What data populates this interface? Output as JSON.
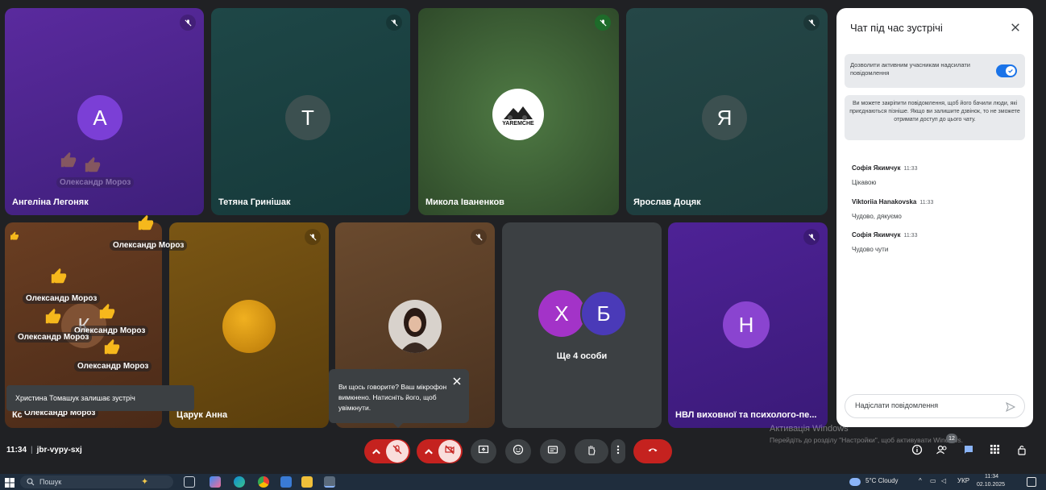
{
  "tiles": {
    "angelina": {
      "name": "Ангеліна Легоняк",
      "initial": "А"
    },
    "tetiana": {
      "name": "Тетяна Гринішак",
      "initial": "Т"
    },
    "mykola": {
      "name": "Микола Іваненков",
      "logo_text": "YAREMCHE"
    },
    "yaroslav": {
      "name": "Ярослав Доцяк",
      "initial": "Я"
    },
    "k_tile": {
      "name": "Кс",
      "initial": "К"
    },
    "tsaruk": {
      "name": "Царук Анна"
    },
    "photo_tile": {},
    "more": {
      "initial_1": "Х",
      "initial_2": "Б",
      "label": "Ще 4 особи"
    },
    "nvl": {
      "name": "НВЛ виховної та психолого-пе...",
      "initial": "Н"
    }
  },
  "reactions": {
    "sender": "Олександр Мороз"
  },
  "chat": {
    "title": "Чат під час зустрічі",
    "allow_label": "Дозволити активним учасникам надсилати повідомлення",
    "pin_info": "Ви можете закріпити повідомлення, щоб його бачили люди, які приєднаються пізніше. Якщо ви залишите дзвінок, то не зможете отримати доступ до цього чату.",
    "messages": [
      {
        "sender": "Софія Якимчук",
        "time": "11:33",
        "text": "Цікавою"
      },
      {
        "sender": "Viktoriia Hanakovska",
        "time": "11:33",
        "text": "Чудово, дякуємо"
      },
      {
        "sender": "Софія Якимчук",
        "time": "11:33",
        "text": "Чудово чути"
      }
    ],
    "input_placeholder": "Надіслати повідомлення"
  },
  "tooltip": {
    "text": "Ви щось говорите? Ваш мікрофон вимкнено. Натисніть його, щоб увімкнути."
  },
  "notification": {
    "text": "Христина Томашук залишає зустріч"
  },
  "meeting": {
    "time": "11:34",
    "code": "jbr-vypy-sxj",
    "participants_badge": "12"
  },
  "watermark": {
    "line1": "Активація Windows",
    "line2": "Перейдіть до розділу \"Настройки\", щоб активувати Windows."
  },
  "taskbar": {
    "search_placeholder": "Пошук",
    "weather": "5°C  Cloudy",
    "lang": "УКР",
    "clock_time": "11:34",
    "clock_date": "02.10.2025"
  },
  "colors": {
    "angelina_bg": "#4a2a8a",
    "tetiana_bg": "#1f4a4a",
    "mykola_bg": "#3d5a36",
    "yaroslav_bg": "#294a4a",
    "k_bg": "#5a3520",
    "tsaruk_bg": "#6b4a10",
    "photo_bg": "#5a4028",
    "more_bg": "#3c4043",
    "nvl_bg": "#46208a",
    "end_call": "#c5221f"
  }
}
